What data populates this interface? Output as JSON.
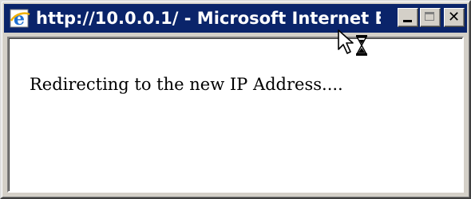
{
  "window": {
    "title": "http://10.0.0.1/ - Microsoft Internet E...",
    "icon": "internet-explorer-icon",
    "controls": {
      "minimize_icon": "minimize-icon",
      "maximize_icon": "maximize-icon",
      "close_icon": "close-icon",
      "close_glyph": "✕"
    }
  },
  "content": {
    "message": "Redirecting to the new IP Address...."
  },
  "cursor": {
    "icon": "busy-arrow-hourglass-cursor"
  },
  "colors": {
    "titlebar": "#0a246a",
    "title_text": "#ffffff",
    "chrome": "#d4d0c8",
    "page_background": "#ffffff",
    "text": "#000000"
  }
}
